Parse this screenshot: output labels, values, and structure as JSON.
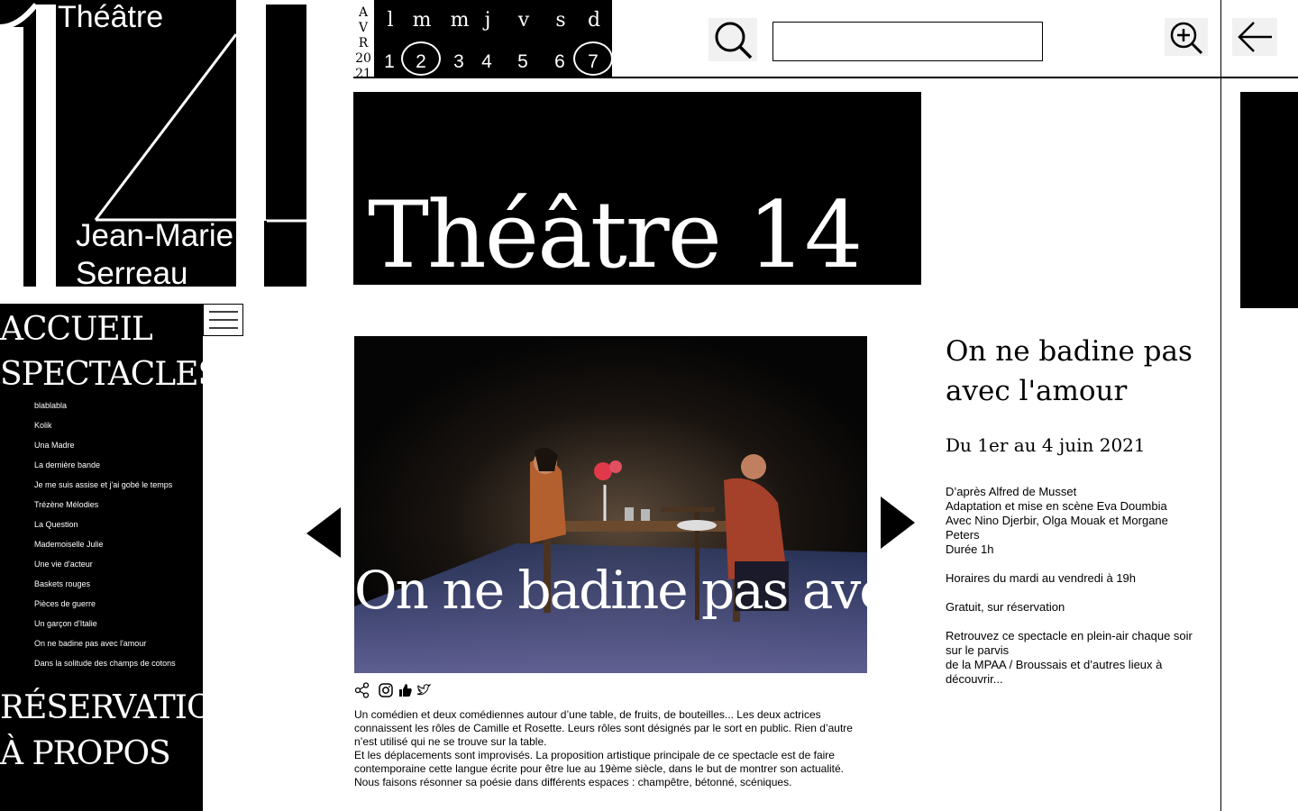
{
  "logo": {
    "word": "Théâtre",
    "name_line1": "Jean-Marie",
    "name_line2": "Serreau"
  },
  "calendar": {
    "month_letters": [
      "A",
      "V",
      "R",
      "20",
      "21"
    ],
    "days": [
      {
        "name": "l",
        "num": "1",
        "circled": false
      },
      {
        "name": "m",
        "num": "2",
        "circled": true
      },
      {
        "name": "m",
        "num": "3",
        "circled": false
      },
      {
        "name": "j",
        "num": "4",
        "circled": false
      },
      {
        "name": "v",
        "num": "5",
        "circled": false
      },
      {
        "name": "s",
        "num": "6",
        "circled": false
      },
      {
        "name": "d",
        "num": "7",
        "circled": true
      }
    ]
  },
  "search": {
    "value": "",
    "placeholder": ""
  },
  "icons": {
    "search": "search-icon",
    "zoom": "zoom-in-icon",
    "back": "arrow-left-icon",
    "menu": "hamburger-icon",
    "prev": "triangle-left-icon",
    "next": "triangle-right-icon"
  },
  "banner": {
    "title": "Théâtre 14"
  },
  "nav": {
    "accueil": "ACCUEIL",
    "spectacles": "SPECTACLES",
    "items": [
      "blablabla",
      "Kolik",
      "Una Madre",
      "La dernière bande",
      "Je me suis assise et j'ai gobé le temps",
      "Trézène Mélodies",
      "La Question",
      "Mademoiselle Julie",
      "Une vie d'acteur",
      "Baskets rouges",
      "Pièces de guerre",
      "Un garçon d'Italie",
      "On ne badine pas avec l'amour",
      "Dans la solitude des champs de cotons"
    ],
    "reservation": "RÉSERVATION",
    "apropos": "À PROPOS"
  },
  "show": {
    "photo_caption": "On ne badine pas avec l'amour",
    "share_icons": [
      "share-icon",
      "instagram-icon",
      "thumbs-up-icon",
      "twitter-icon"
    ],
    "description": [
      "Un comédien et deux comédiennes autour d’une table, de fruits, de bouteilles... Les deux actrices connaissent les rôles de Camille et Rosette. Leurs rôles sont désignés par le sort en public. Rien d’autre n’est utilisé qui ne se trouve sur la table.",
      "Et les déplacements sont improvisés. La proposition artistique principale de ce spectacle est de faire contemporaine cette langue écrite pour être lue au 19ème siècle, dans le but de montrer son actualité. Nous faisons résonner sa poésie dans différents espaces : champêtre, bétonné, scéniques."
    ]
  },
  "info": {
    "title": "On ne badine pas avec l'amour",
    "dates": "Du 1er au 4 juin 2021",
    "credits": [
      "D’après Alfred de Musset",
      "Adaptation et mise en scène Eva Doumbia",
      "Avec Nino Djerbir, Olga Mouak et Morgane Peters",
      "Durée 1h"
    ],
    "horaires": "Horaires du mardi au vendredi à 19h",
    "tarif": "Gratuit, sur réservation",
    "extra_line1": "Retrouvez ce spectacle en plein-air chaque soir sur le parvis",
    "extra_line2": "de la MPAA / Broussais et d’autres lieux à découvrir..."
  }
}
